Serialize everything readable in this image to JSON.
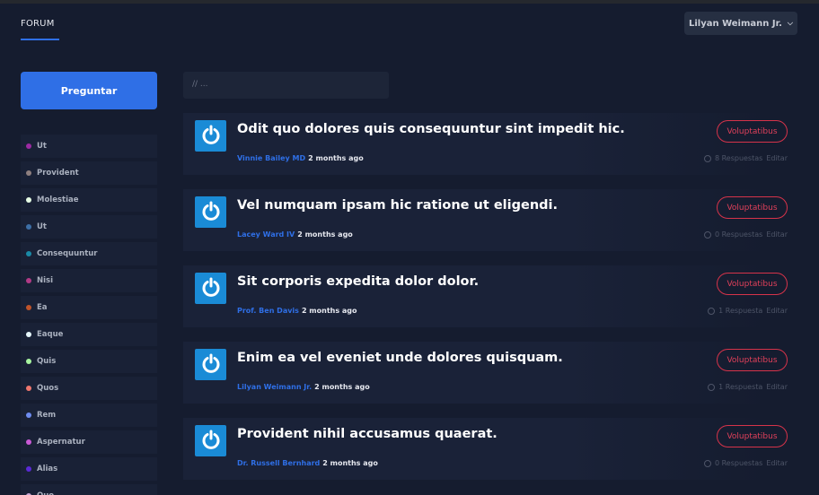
{
  "nav": {
    "tab": "FORUM",
    "user": "Lilyan Weimann Jr."
  },
  "ask_button": "Preguntar",
  "search": {
    "placeholder": "// ..."
  },
  "categories": [
    {
      "label": "Ut",
      "color": "#9c2aa3"
    },
    {
      "label": "Provident",
      "color": "#8e7f7f"
    },
    {
      "label": "Molestiae",
      "color": "#e7ffe6"
    },
    {
      "label": "Ut",
      "color": "#3d6fa6"
    },
    {
      "label": "Consequuntur",
      "color": "#1a8aa6"
    },
    {
      "label": "Nisi",
      "color": "#b23a86"
    },
    {
      "label": "Ea",
      "color": "#c0542a"
    },
    {
      "label": "Eaque",
      "color": "#e6f7fb"
    },
    {
      "label": "Quis",
      "color": "#a8f5a0"
    },
    {
      "label": "Quos",
      "color": "#f0776e"
    },
    {
      "label": "Rem",
      "color": "#6e8cf0"
    },
    {
      "label": "Aspernatur",
      "color": "#c95ad6"
    },
    {
      "label": "Alias",
      "color": "#5a2ad6"
    },
    {
      "label": "Quo",
      "color": "#c8a8d6"
    }
  ],
  "posts": [
    {
      "title": "Odit quo dolores quis consequuntur sint impedit hic.",
      "author": "Vinnie Bailey MD",
      "time": "2 months ago",
      "tag": "Voluptatibus",
      "replies": "8 Respuestas",
      "edit": "Editar"
    },
    {
      "title": "Vel numquam ipsam hic ratione ut eligendi.",
      "author": "Lacey Ward IV",
      "time": "2 months ago",
      "tag": "Voluptatibus",
      "replies": "0 Respuestas",
      "edit": "Editar"
    },
    {
      "title": "Sit corporis expedita dolor dolor.",
      "author": "Prof. Ben Davis",
      "time": "2 months ago",
      "tag": "Voluptatibus",
      "replies": "1 Respuesta",
      "edit": "Editar"
    },
    {
      "title": "Enim ea vel eveniet unde dolores quisquam.",
      "author": "Lilyan Weimann Jr.",
      "time": "2 months ago",
      "tag": "Voluptatibus",
      "replies": "1 Respuesta",
      "edit": "Editar"
    },
    {
      "title": "Provident nihil accusamus quaerat.",
      "author": "Dr. Russell Bernhard",
      "time": "2 months ago",
      "tag": "Voluptatibus",
      "replies": "0 Respuestas",
      "edit": "Editar"
    }
  ]
}
